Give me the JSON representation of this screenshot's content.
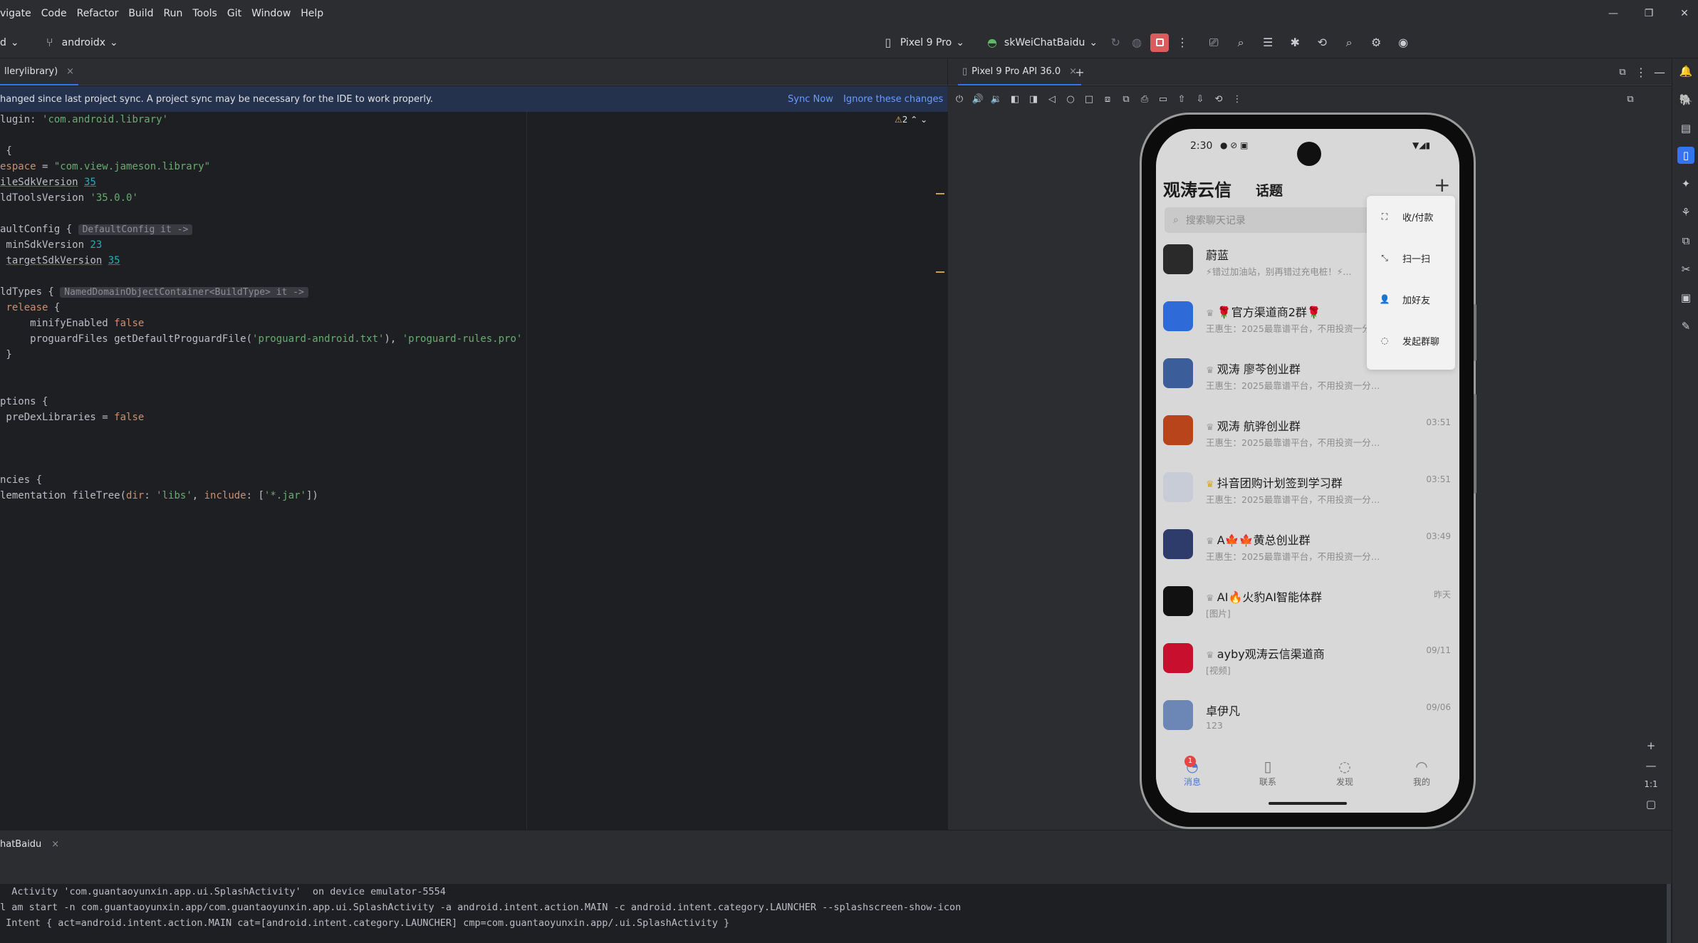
{
  "menu": [
    "vigate",
    "Code",
    "Refactor",
    "Build",
    "Run",
    "Tools",
    "Git",
    "Window",
    "Help"
  ],
  "window_controls": [
    "—",
    "❐",
    "✕"
  ],
  "toolbar": {
    "project_fragment": "d",
    "branch": "androidx",
    "device": "Pixel 9 Pro",
    "run_config": "skWeiChatBaidu"
  },
  "editor": {
    "tab_label": "llerylibrary)",
    "banner_text": "hanged since last project sync. A project sync may be necessary for the IDE to work properly.",
    "sync_now": "Sync Now",
    "ignore": "Ignore these changes",
    "warnings": "2",
    "hint_default_config": "DefaultConfig it ->",
    "hint_build_types": "NamedDomainObjectContainer<BuildType> it ->"
  },
  "emulator": {
    "tab_label": "Pixel 9 Pro API 36.0",
    "zoom_label": "1:1"
  },
  "phone": {
    "status_time": "2:30",
    "app_title": "观涛云信",
    "topic": "话题",
    "search_placeholder": "搜索聊天记录",
    "popup": [
      {
        "icon": "scan-pay-icon",
        "label": "收/付款"
      },
      {
        "icon": "scan-icon",
        "label": "扫一扫"
      },
      {
        "icon": "add-friend-icon",
        "label": "加好友"
      },
      {
        "icon": "group-chat-icon",
        "label": "发起群聊"
      }
    ],
    "chats": [
      {
        "name": "蔚蓝",
        "msg": "⚡错过加油站，别再错过充电桩！⚡...",
        "time": "",
        "crown": false,
        "avatar_color": "#2a2a2a"
      },
      {
        "name": "🌹官方渠道商2群🌹",
        "msg": "王惠生：2025最靠谱平台，不用投资一分钱，国...",
        "time": "",
        "crown": true,
        "avatar_color": "#2f6bd8"
      },
      {
        "name": "观涛 廖芩创业群",
        "msg": "王惠生：2025最靠谱平台，不用投资一分钱，国...",
        "time": "03:52",
        "crown": true,
        "avatar_color": "#3b5e9a"
      },
      {
        "name": "观涛 航骅创业群",
        "msg": "王惠生：2025最靠谱平台，不用投资一分钱，国...",
        "time": "03:51",
        "crown": true,
        "avatar_color": "#b8441c"
      },
      {
        "name": "抖音团购计划签到学习群",
        "msg": "王惠生：2025最靠谱平台，不用投资一分钱，国...",
        "time": "03:51",
        "crown": true,
        "crown_gold": true,
        "avatar_color": "#c7ccd6"
      },
      {
        "name": "A🍁🍁黄总创业群",
        "msg": "王惠生：2025最靠谱平台，不用投资一分钱，国...",
        "time": "03:49",
        "crown": true,
        "avatar_color": "#2d3c6a"
      },
      {
        "name": "AI🔥火豹AI智能体群",
        "msg": "[图片]",
        "time": "昨天",
        "crown": true,
        "avatar_color": "#111111"
      },
      {
        "name": "ayby观涛云信渠道商",
        "msg": "[视频]",
        "time": "09/11",
        "crown": true,
        "avatar_color": "#c8102e"
      },
      {
        "name": "卓伊凡",
        "msg": "123",
        "time": "09/06",
        "crown": false,
        "avatar_color": "#6c87b5"
      }
    ],
    "nav": [
      {
        "label": "消息",
        "icon": "message-icon",
        "badge": "1"
      },
      {
        "label": "联系",
        "icon": "contacts-icon"
      },
      {
        "label": "发现",
        "icon": "discover-icon"
      },
      {
        "label": "我的",
        "icon": "profile-icon"
      }
    ],
    "nav_active_color": "#4a78c8"
  },
  "bottom": {
    "tab_label": "hatBaidu",
    "console": [
      "  Activity 'com.guantaoyunxin.app.ui.SplashActivity'  on device emulator-5554",
      "l am start -n com.guantaoyunxin.app/com.guantaoyunxin.app.ui.SplashActivity -a android.intent.action.MAIN -c android.intent.category.LAUNCHER --splashscreen-show-icon",
      " Intent { act=android.intent.action.MAIN cat=[android.intent.category.LAUNCHER] cmp=com.guantaoyunxin.app/.ui.SplashActivity }"
    ]
  }
}
